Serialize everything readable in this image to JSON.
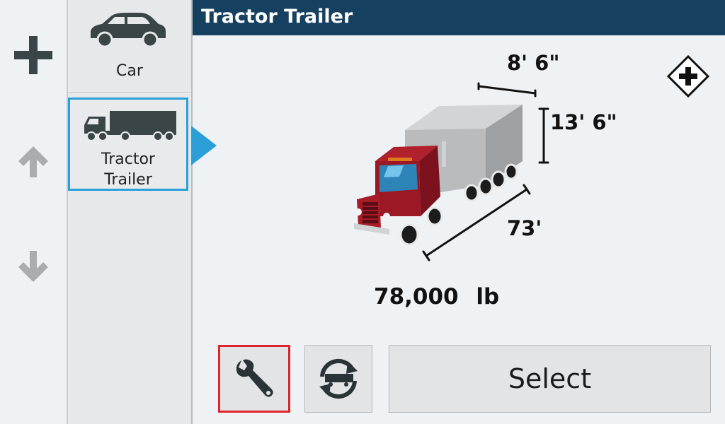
{
  "header": {
    "title": "Tractor Trailer"
  },
  "nav": {
    "add_icon": "plus-icon",
    "up_icon": "arrow-up-icon",
    "down_icon": "arrow-down-icon"
  },
  "profiles": [
    {
      "label": "Car",
      "icon": "car-icon",
      "selected": false
    },
    {
      "label_line1": "Tractor",
      "label_line2": "Trailer",
      "icon": "tractor-trailer-icon",
      "selected": true
    }
  ],
  "vehicle": {
    "width": "8' 6\"",
    "height": "13' 6\"",
    "length": "73'",
    "weight": "78,000 lb"
  },
  "actions": {
    "settings_icon": "wrench-icon",
    "swap_icon": "trailer-swap-icon",
    "select_label": "Select"
  },
  "colors": {
    "header_bg": "#16405f",
    "accent": "#2a9fd8",
    "highlight_border": "#e0232a"
  }
}
